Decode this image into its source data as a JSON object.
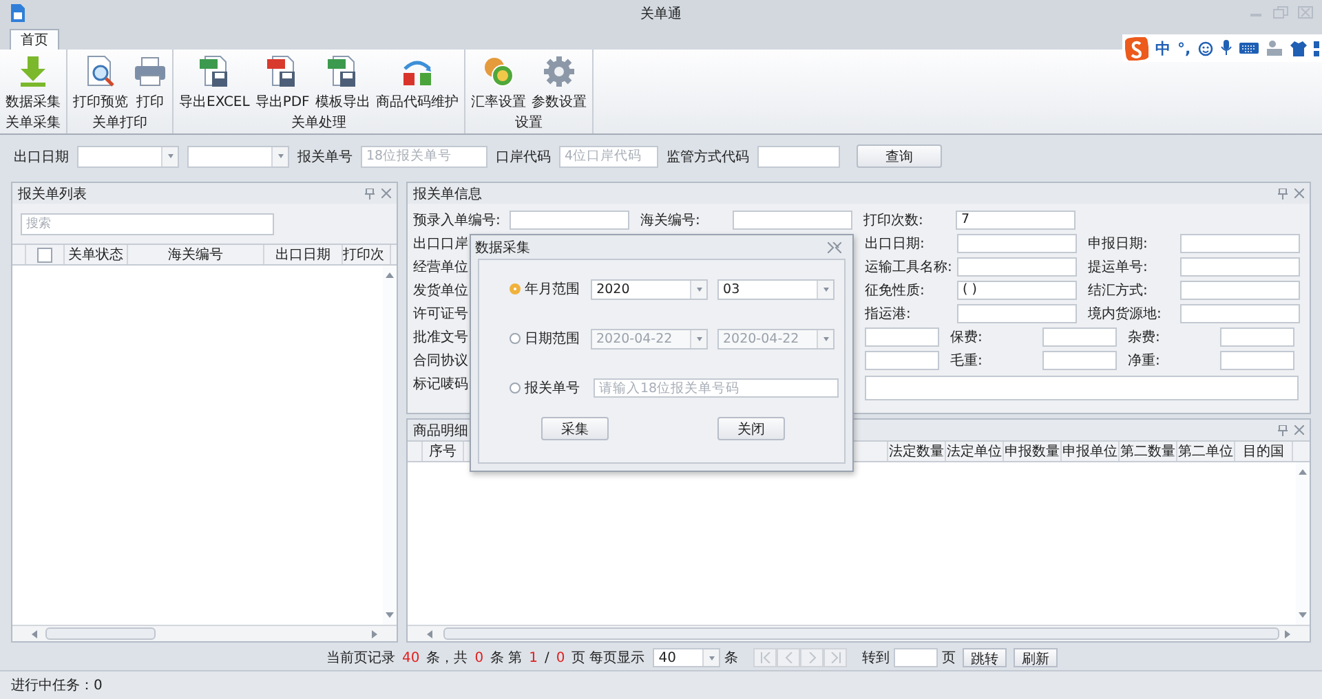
{
  "window": {
    "title": "关单通"
  },
  "ime_toolbar": {
    "mode": "中",
    "punct": "°,"
  },
  "tabs": [
    {
      "label": "首页",
      "selected": true
    }
  ],
  "ribbon": {
    "groups": [
      {
        "label": "关单采集",
        "buttons": [
          {
            "label": "数据采集",
            "kind": "download"
          }
        ]
      },
      {
        "label": "关单打印",
        "buttons": [
          {
            "label": "打印预览",
            "kind": "preview"
          },
          {
            "label": "打印",
            "kind": "printer"
          }
        ]
      },
      {
        "label": "关单处理",
        "buttons": [
          {
            "label": "导出EXCEL",
            "kind": "excel"
          },
          {
            "label": "导出PDF",
            "kind": "pdf"
          },
          {
            "label": "模板导出",
            "kind": "template"
          },
          {
            "label": "商品代码维护",
            "kind": "swap"
          }
        ]
      },
      {
        "label": "设置",
        "buttons": [
          {
            "label": "汇率设置",
            "kind": "coins"
          },
          {
            "label": "参数设置",
            "kind": "gear"
          }
        ]
      }
    ]
  },
  "filter": {
    "items": [
      {
        "kind": "label",
        "text": "出口日期"
      },
      {
        "kind": "select"
      },
      {
        "kind": "select"
      },
      {
        "kind": "label",
        "text": "报关单号"
      },
      {
        "kind": "input",
        "placeholder": "18位报关单号"
      },
      {
        "kind": "label",
        "text": "口岸代码"
      },
      {
        "kind": "mid_input",
        "placeholder": "4位口岸代码"
      },
      {
        "kind": "label",
        "text": "监管方式代码"
      },
      {
        "kind": "short_input"
      }
    ],
    "button": "查询"
  },
  "list_panel": {
    "title": "报关单列表",
    "search": {
      "placeholder": "搜索"
    },
    "select_all": {
      "checked": false
    },
    "columns": [
      "关单状态",
      "海关编号",
      "出口日期",
      "打印次"
    ]
  },
  "info_panel": {
    "title": "报关单信息",
    "rows": [
      {
        "lead": "预录入单编号:",
        "items": [
          {
            "kind": "field"
          },
          {
            "kind": "label",
            "text": "海关编号:"
          },
          {
            "kind": "field"
          },
          {
            "kind": "label",
            "text": "打印次数:"
          },
          {
            "kind": "field",
            "value": "7"
          }
        ]
      },
      {
        "lead": "出口口岸",
        "items": [
          {
            "kind": "label",
            "text": "出口日期:"
          },
          {
            "kind": "field"
          },
          {
            "kind": "label",
            "text": "申报日期:"
          },
          {
            "kind": "field"
          }
        ]
      },
      {
        "lead": "经营单位",
        "items": [
          {
            "kind": "label",
            "text": "运输工具名称:"
          },
          {
            "kind": "field"
          },
          {
            "kind": "label",
            "text": "提运单号:"
          },
          {
            "kind": "field"
          }
        ]
      },
      {
        "lead": "发货单位",
        "items": [
          {
            "kind": "label",
            "text": "征免性质:"
          },
          {
            "kind": "field",
            "value": "( )"
          },
          {
            "kind": "label",
            "text": "结汇方式:"
          },
          {
            "kind": "field"
          }
        ]
      },
      {
        "lead": "许可证号",
        "items": [
          {
            "kind": "label",
            "text": "指运港:"
          },
          {
            "kind": "field"
          },
          {
            "kind": "label",
            "text": "境内货源地:"
          },
          {
            "kind": "field"
          }
        ]
      },
      {
        "lead": "批准文号",
        "items": [
          {
            "kind": "short_field"
          },
          {
            "kind": "label",
            "text": "保费:"
          },
          {
            "kind": "short_field"
          },
          {
            "kind": "label",
            "text": "杂费:"
          },
          {
            "kind": "short_field"
          }
        ]
      },
      {
        "lead": "合同协议",
        "items": [
          {
            "kind": "short_field"
          },
          {
            "kind": "label",
            "text": "毛重:"
          },
          {
            "kind": "short_field"
          },
          {
            "kind": "label",
            "text": "净重:"
          },
          {
            "kind": "short_field"
          }
        ]
      },
      {
        "lead": "标记唛码",
        "items": [
          {
            "kind": "wide_field"
          }
        ]
      }
    ]
  },
  "detail_panel": {
    "title": "商品明细",
    "first_column": "序号",
    "columns": [
      "法定数量",
      "法定单位",
      "申报数量",
      "申报单位",
      "第二数量",
      "第二单位",
      "目的国"
    ]
  },
  "dialog": {
    "title": "数据采集",
    "options": [
      {
        "label": "年月范围",
        "selected": true,
        "kind": "range",
        "fields": [
          {
            "value": "2020",
            "disabled": false
          },
          {
            "value": "03",
            "disabled": false
          }
        ]
      },
      {
        "label": "日期范围",
        "selected": false,
        "kind": "range",
        "fields": [
          {
            "value": "2020-04-22",
            "disabled": true
          },
          {
            "value": "2020-04-22",
            "disabled": true
          }
        ]
      },
      {
        "label": "报关单号",
        "selected": false,
        "kind": "text",
        "placeholder": "请输入18位报关单号码"
      }
    ],
    "buttons": [
      "采集",
      "关闭"
    ]
  },
  "pager": {
    "pieces": [
      {
        "kind": "label",
        "text": "当前页记录"
      },
      {
        "kind": "count",
        "text": "40"
      },
      {
        "kind": "label",
        "text": "条，共"
      },
      {
        "kind": "count",
        "text": "0"
      },
      {
        "kind": "label",
        "text": "条"
      },
      {
        "kind": "label",
        "text": "第"
      },
      {
        "kind": "count",
        "text": "1"
      },
      {
        "kind": "label",
        "text": "/"
      },
      {
        "kind": "count",
        "text": "0"
      },
      {
        "kind": "label",
        "text": "页"
      },
      {
        "kind": "label",
        "text": "每页显示"
      }
    ],
    "page_size": "40",
    "size_unit": "条",
    "nav_disabled": true,
    "goto_label": "转到",
    "page_unit": "页",
    "buttons": [
      "跳转",
      "刷新"
    ]
  },
  "status_bar": {
    "text": "进行中任务：0"
  }
}
